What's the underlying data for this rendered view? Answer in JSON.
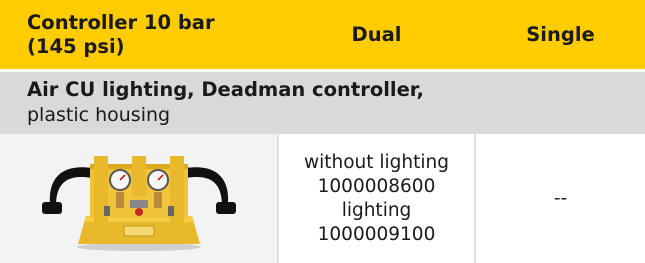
{
  "header": {
    "controller_label_line1": "Controller 10 bar",
    "controller_label_line2": "(145 psi)",
    "dual_label": "Dual",
    "single_label": "Single"
  },
  "section": {
    "title": "Air CU lighting, Deadman controller,",
    "subtitle": "plastic housing"
  },
  "product": {
    "image_icon": "deadman-controller-image",
    "dual_lines": [
      "without lighting",
      "1000008600",
      "lighting",
      "1000009100"
    ],
    "single_value": "--"
  },
  "colors": {
    "header_bg": "#ffcc00",
    "section_bg": "#d9d9d9",
    "text": "#1a1a1a"
  }
}
